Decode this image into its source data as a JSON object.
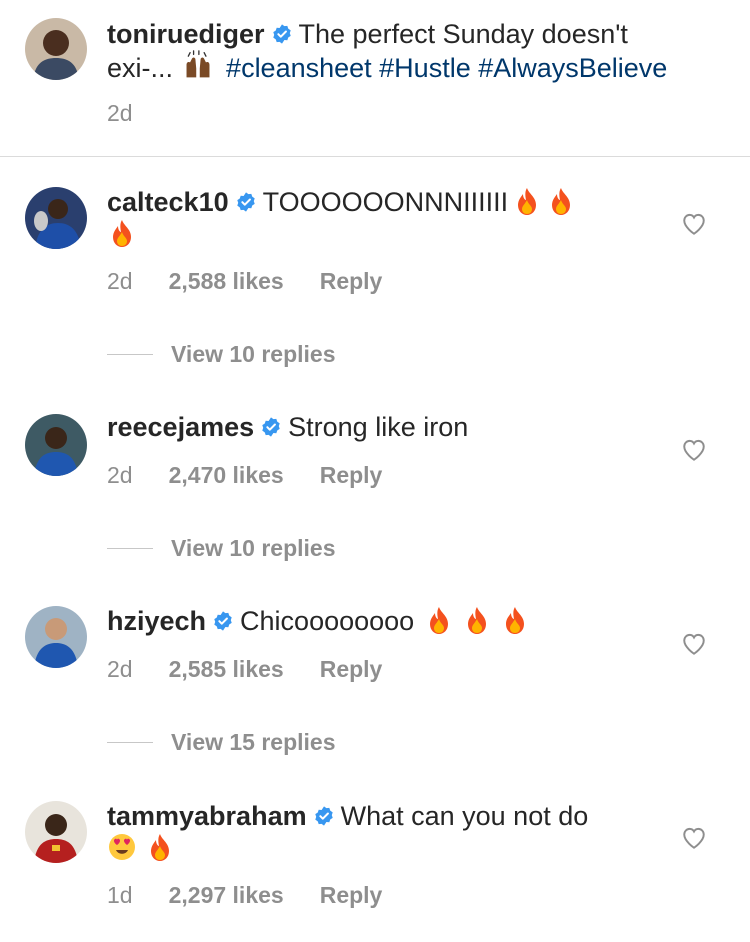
{
  "caption": {
    "username": "toniruediger",
    "text_line1": "The perfect Sunday doesn't",
    "text_line2": "exi-...",
    "hashtags": "#cleansheet #Hustle #AlwaysBelieve",
    "time": "2d",
    "emoji": "raising-hands-emoji"
  },
  "comments": [
    {
      "username": "calteck10",
      "text": "TOOOOOONNNIIIIII",
      "emojis": [
        "fire",
        "fire",
        "fire"
      ],
      "time": "2d",
      "likes": "2,588 likes",
      "reply": "Reply",
      "view_replies": "View 10 replies"
    },
    {
      "username": "reecejames",
      "text": "Strong like iron",
      "emojis": [],
      "time": "2d",
      "likes": "2,470 likes",
      "reply": "Reply",
      "view_replies": "View 10 replies"
    },
    {
      "username": "hziyech",
      "text": "Chicoooooooo",
      "emojis": [
        "fire",
        "fire",
        "fire"
      ],
      "time": "2d",
      "likes": "2,585 likes",
      "reply": "Reply",
      "view_replies": "View 15 replies"
    },
    {
      "username": "tammyabraham",
      "text": "What can you not do",
      "emojis": [
        "heart-eyes",
        "fire"
      ],
      "time": "1d",
      "likes": "2,297 likes",
      "reply": "Reply"
    }
  ],
  "colors": {
    "text": "#262626",
    "secondary": "#8e8e8e",
    "hashtag": "#00376b",
    "verified": "#3897f0",
    "divider": "#dbdbdb"
  }
}
